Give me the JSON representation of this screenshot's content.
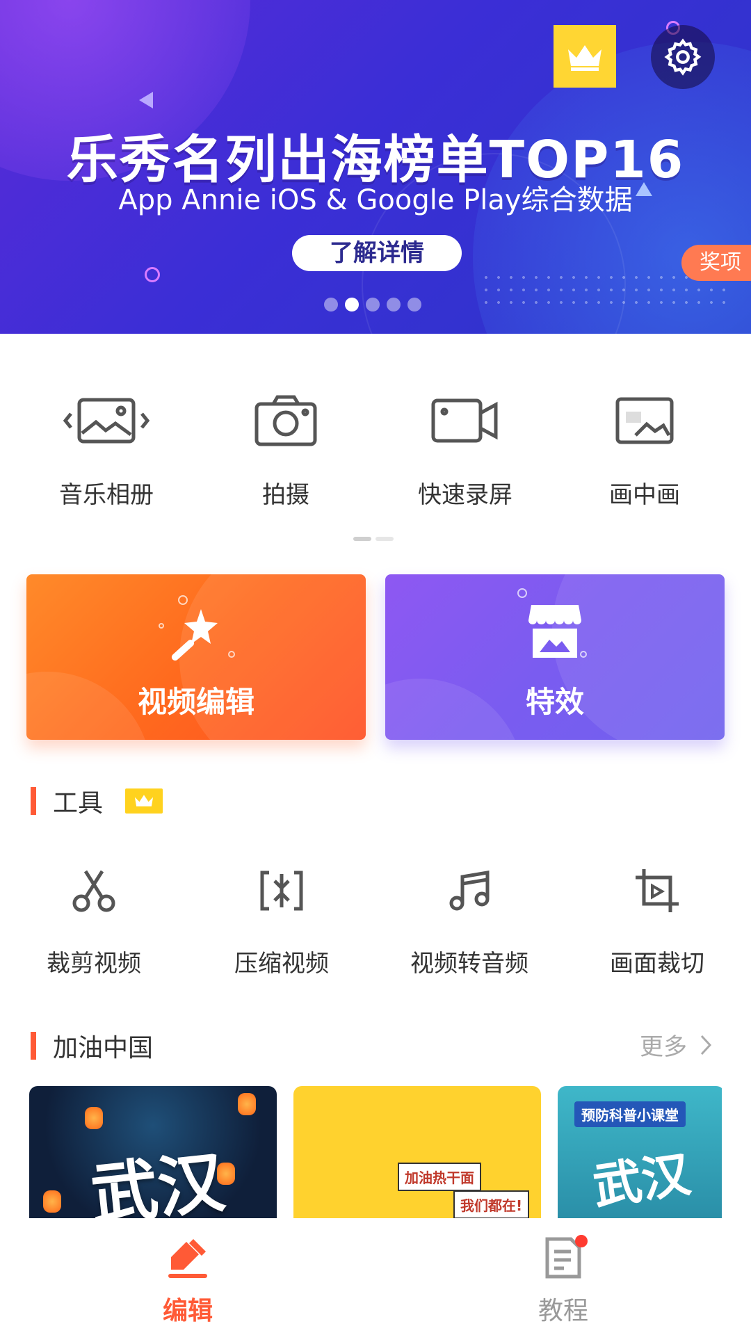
{
  "banner": {
    "title": "乐秀名列出海榜单TOP16",
    "subtitle": "App Annie iOS & Google Play综合数据",
    "cta_label": "了解详情",
    "award_tag": "奖项",
    "carousel": {
      "count": 5,
      "active_index": 1
    }
  },
  "header": {
    "vip_icon": "crown-icon",
    "settings_icon": "gear-icon"
  },
  "quick_actions": [
    {
      "label": "音乐相册",
      "icon": "photo-album-icon"
    },
    {
      "label": "拍摄",
      "icon": "camera-icon"
    },
    {
      "label": "快速录屏",
      "icon": "screen-record-icon"
    },
    {
      "label": "画中画",
      "icon": "picture-in-picture-icon"
    }
  ],
  "feature_cards": {
    "edit": {
      "label": "视频编辑",
      "icon": "magic-wand-icon"
    },
    "effects": {
      "label": "特效",
      "icon": "store-icon"
    }
  },
  "tools_section": {
    "title": "工具",
    "items": [
      {
        "label": "裁剪视频",
        "icon": "scissors-icon"
      },
      {
        "label": "压缩视频",
        "icon": "compress-icon"
      },
      {
        "label": "视频转音频",
        "icon": "music-note-icon"
      },
      {
        "label": "画面裁切",
        "icon": "crop-icon"
      }
    ]
  },
  "cheer_section": {
    "title": "加油中国",
    "more_label": "更多",
    "thumbnails": [
      {
        "text": "武汉"
      },
      {
        "signs": [
          "加油热干面",
          "我们都在!"
        ]
      },
      {
        "banner": "预防科普小课堂",
        "text": "武汉"
      }
    ]
  },
  "bottom_nav": {
    "tabs": [
      {
        "label": "编辑",
        "icon": "pencil-edit-icon",
        "active": true
      },
      {
        "label": "教程",
        "icon": "document-icon",
        "active": false,
        "badge": true
      }
    ]
  },
  "colors": {
    "accent": "#ff5a36",
    "edit_card": "#ff6a1e",
    "effects_card": "#7a5cf0",
    "vip_yellow": "#ffd633"
  }
}
